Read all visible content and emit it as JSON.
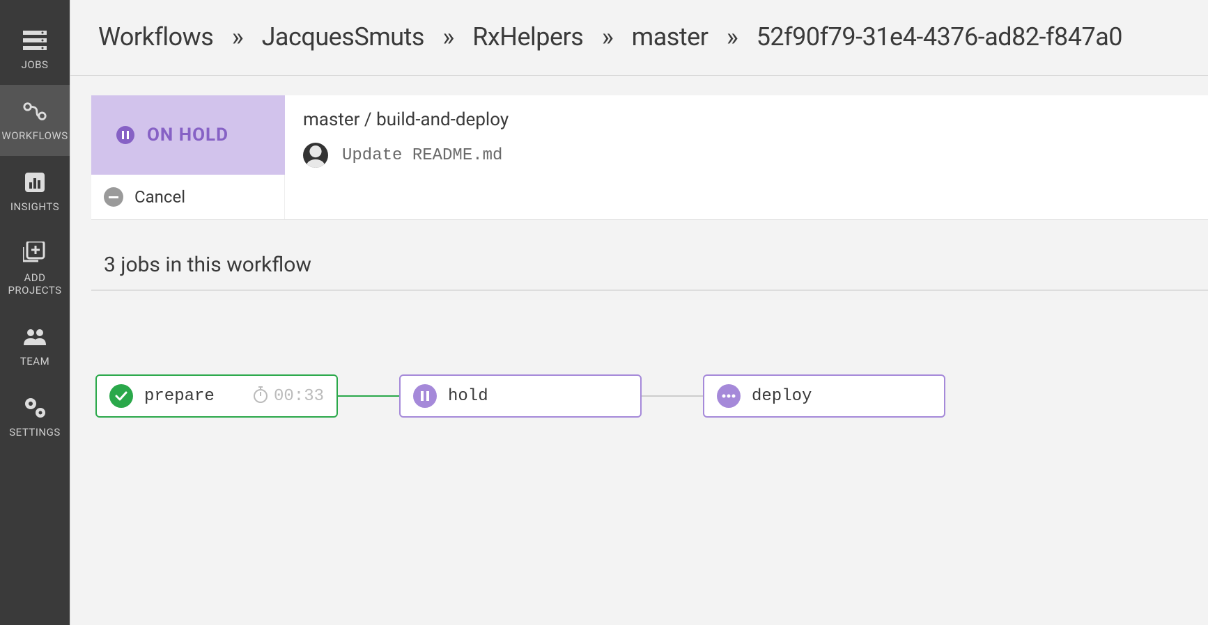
{
  "sidebar": {
    "items": [
      {
        "label": "JOBS"
      },
      {
        "label": "WORKFLOWS"
      },
      {
        "label": "INSIGHTS"
      },
      {
        "label": "ADD PROJECTS"
      },
      {
        "label": "TEAM"
      },
      {
        "label": "SETTINGS"
      }
    ]
  },
  "breadcrumb": {
    "items": [
      "Workflows",
      "JacquesSmuts",
      "RxHelpers",
      "master",
      "52f90f79-31e4-4376-ad82-f847a0"
    ]
  },
  "status": {
    "label": "ON HOLD",
    "cancel": "Cancel",
    "title": "master / build-and-deploy",
    "commit_message": "Update README.md"
  },
  "section_heading": "3 jobs in this workflow",
  "jobs": [
    {
      "name": "prepare",
      "time": "00:33",
      "status": "success"
    },
    {
      "name": "hold",
      "status": "hold"
    },
    {
      "name": "deploy",
      "status": "pending"
    }
  ]
}
